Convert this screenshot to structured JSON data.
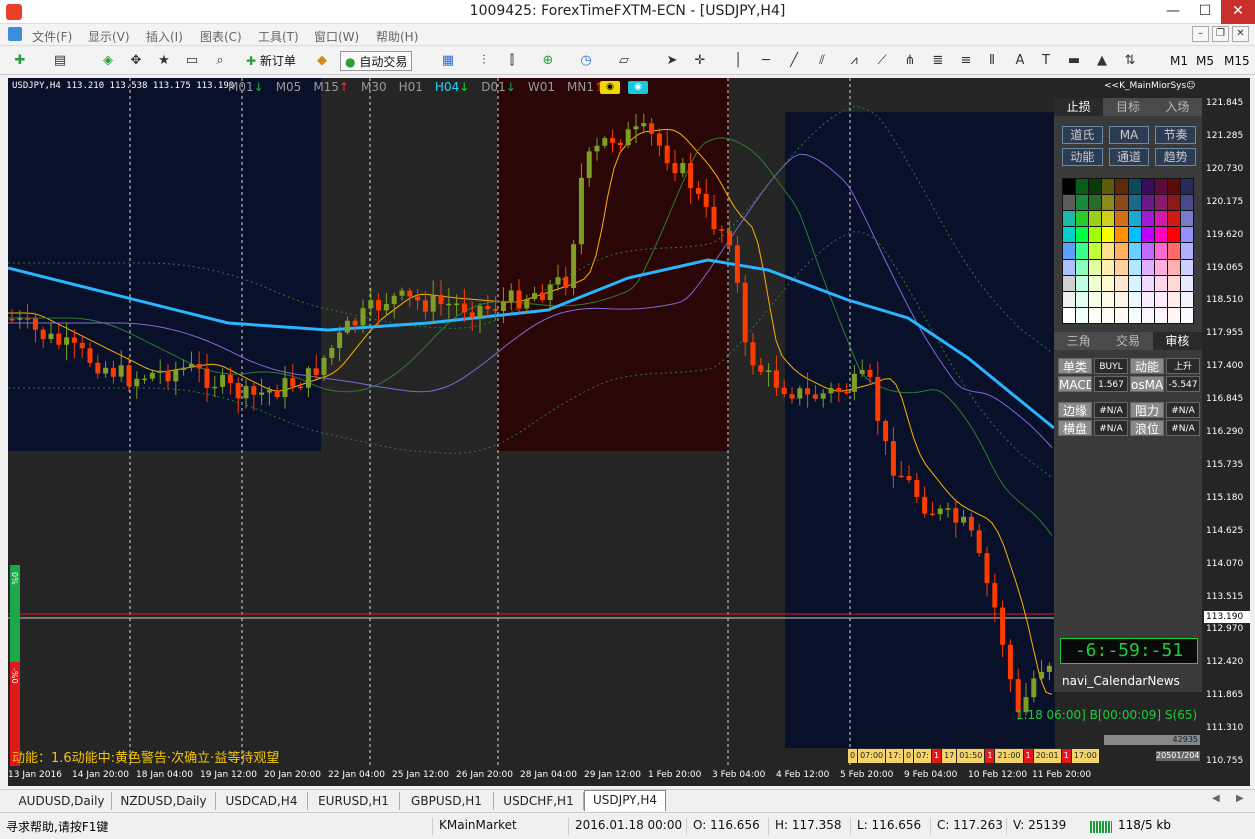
{
  "window": {
    "title": "1009425: ForexTimeFXTM-ECN - [USDJPY,H4]",
    "min": "—",
    "max": "☐",
    "close": "✕"
  },
  "menu": [
    "文件(F)",
    "显示(V)",
    "插入(I)",
    "图表(C)",
    "工具(T)",
    "窗口(W)",
    "帮助(H)"
  ],
  "toolbar": {
    "new_order": "新订单",
    "auto_trade": "自动交易",
    "tf1": "M1",
    "tf5": "M5",
    "tf15": "M15"
  },
  "chart": {
    "symbol_info": "USDJPY,H4  113.210 113.538 113.175 113.190",
    "timeframes": [
      {
        "label": "M01",
        "arrow": "↓",
        "dir": "down"
      },
      {
        "label": "M05",
        "arrow": "",
        "dir": "none"
      },
      {
        "label": "M15",
        "arrow": "↑",
        "dir": "up"
      },
      {
        "label": "M30",
        "arrow": "",
        "dir": "none"
      },
      {
        "label": "H01",
        "arrow": "",
        "dir": "none"
      },
      {
        "label": "H04",
        "arrow": "↓",
        "dir": "active"
      },
      {
        "label": "D01",
        "arrow": "↓",
        "dir": "down"
      },
      {
        "label": "W01",
        "arrow": "",
        "dir": "none"
      },
      {
        "label": "MN1",
        "arrow": "↑",
        "dir": "up"
      }
    ],
    "brand": "<<K_MainMiorSys☺",
    "price_ticks": [
      "121.845",
      "121.285",
      "120.730",
      "120.175",
      "119.620",
      "119.065",
      "118.510",
      "117.955",
      "117.400",
      "116.845",
      "116.290",
      "115.735",
      "115.180",
      "114.625",
      "114.070",
      "113.515",
      "112.970",
      "112.420",
      "111.865",
      "111.310",
      "110.755"
    ],
    "current_price": "113.190",
    "time_ticks": [
      "13 Jan 2016",
      "14 Jan 20:00",
      "18 Jan 04:00",
      "19 Jan 12:00",
      "20 Jan 20:00",
      "22 Jan 04:00",
      "25 Jan 12:00",
      "26 Jan 20:00",
      "28 Jan 04:00",
      "29 Jan 12:00",
      "1 Feb 20:00",
      "3 Feb 04:00",
      "4 Feb 12:00",
      "5 Feb 20:00",
      "9 Feb 04:00",
      "10 Feb 12:00",
      "11 Feb 20:00"
    ],
    "status_line": "动能：1.6动能中:黄色警告·次确立·益等待观望",
    "bottom_info": "1.18 06:00] B[00:00:09] S(65)",
    "pct_top": "0%",
    "pct_bottom": "-%0",
    "vol_a": "42935",
    "vol_b": "20501/204",
    "time_boxes": [
      "0",
      "07:00",
      "17:",
      "0",
      "07:",
      "1",
      "17",
      "01:50",
      "1",
      "21:00",
      "1",
      "20:01",
      "1",
      "17:00"
    ]
  },
  "panel": {
    "tabs1": [
      "止损",
      "目标",
      "入场"
    ],
    "btns1": [
      "道氏",
      "MA",
      "节奏",
      "动能",
      "通道",
      "趋势"
    ],
    "tabs2": [
      "三角",
      "交易",
      "审核"
    ],
    "rows": [
      [
        "单类",
        "BUYL",
        "动能",
        "上升"
      ],
      [
        "MACD",
        "1.567",
        "osMA",
        "-5.547"
      ],
      [
        "边缘",
        "#N/A",
        "阻力",
        "#N/A"
      ],
      [
        "横盘",
        "#N/A",
        "浪位",
        "#N/A"
      ]
    ],
    "timer": "-6:-59:-51",
    "calendar": "navi_CalendarNews"
  },
  "symbol_tabs": [
    "AUDUSD,Daily",
    "NZDUSD,Daily",
    "USDCAD,H4",
    "EURUSD,H1",
    "GBPUSD,H1",
    "USDCHF,H1",
    "USDJPY,H4"
  ],
  "statusbar": {
    "help": "寻求帮助,请按F1键",
    "profile": "KMainMarket",
    "date": "2016.01.18 00:00",
    "open": "O: 116.656",
    "high": "H: 117.358",
    "low": "L: 116.656",
    "close": "C: 117.263",
    "volume": "V: 25139",
    "traffic": "118/5 kb"
  },
  "colors": {
    "bull": "#7e9f25",
    "bear": "#ff3c00",
    "ma_main": "#2bb5ff",
    "panel_bg": "#3a3a3a",
    "night": "#08102a",
    "red_zone": "#2a0606"
  }
}
